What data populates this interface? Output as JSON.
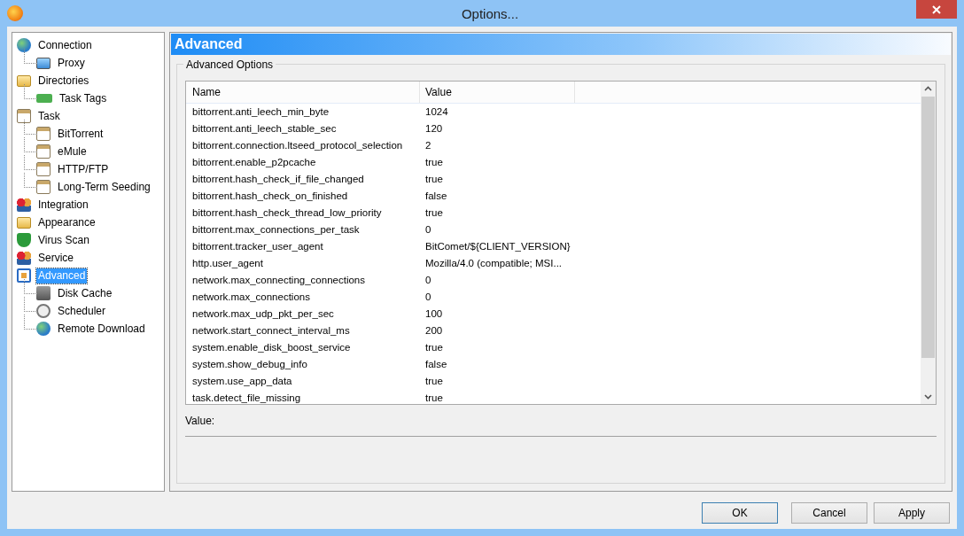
{
  "window": {
    "title": "Options..."
  },
  "sidebar": {
    "items": [
      {
        "label": "Connection",
        "selected": false,
        "children": [
          {
            "label": "Proxy",
            "selected": false
          }
        ]
      },
      {
        "label": "Directories",
        "selected": false,
        "children": [
          {
            "label": "Task Tags",
            "selected": false
          }
        ]
      },
      {
        "label": "Task",
        "selected": false,
        "children": [
          {
            "label": "BitTorrent",
            "selected": false
          },
          {
            "label": "eMule",
            "selected": false
          },
          {
            "label": "HTTP/FTP",
            "selected": false
          },
          {
            "label": "Long-Term Seeding",
            "selected": false
          }
        ]
      },
      {
        "label": "Integration",
        "selected": false
      },
      {
        "label": "Appearance",
        "selected": false
      },
      {
        "label": "Virus Scan",
        "selected": false
      },
      {
        "label": "Service",
        "selected": false
      },
      {
        "label": "Advanced",
        "selected": true,
        "children": [
          {
            "label": "Disk Cache",
            "selected": false
          },
          {
            "label": "Scheduler",
            "selected": false
          },
          {
            "label": "Remote Download",
            "selected": false
          }
        ]
      }
    ]
  },
  "page_header": "Advanced",
  "group": {
    "title": "Advanced Options",
    "table": {
      "columns": [
        "Name",
        "Value"
      ],
      "rows": [
        [
          "bittorrent.anti_leech_min_byte",
          "1024"
        ],
        [
          "bittorrent.anti_leech_stable_sec",
          "120"
        ],
        [
          "bittorrent.connection.ltseed_protocol_selection",
          "2"
        ],
        [
          "bittorrent.enable_p2pcache",
          "true"
        ],
        [
          "bittorrent.hash_check_if_file_changed",
          "true"
        ],
        [
          "bittorrent.hash_check_on_finished",
          "false"
        ],
        [
          "bittorrent.hash_check_thread_low_priority",
          "true"
        ],
        [
          "bittorrent.max_connections_per_task",
          "0"
        ],
        [
          "bittorrent.tracker_user_agent",
          "BitComet/${CLIENT_VERSION}"
        ],
        [
          "http.user_agent",
          "Mozilla/4.0 (compatible; MSI..."
        ],
        [
          "network.max_connecting_connections",
          "0"
        ],
        [
          "network.max_connections",
          "0"
        ],
        [
          "network.max_udp_pkt_per_sec",
          "100"
        ],
        [
          "network.start_connect_interval_ms",
          "200"
        ],
        [
          "system.enable_disk_boost_service",
          "true"
        ],
        [
          "system.show_debug_info",
          "false"
        ],
        [
          "system.use_app_data",
          "true"
        ],
        [
          "task.detect_file_missing",
          "true"
        ]
      ]
    },
    "value_label": "Value:"
  },
  "buttons": [
    {
      "label": "OK",
      "default": true
    },
    {
      "label": "Cancel",
      "default": false
    },
    {
      "label": "Apply",
      "default": false
    }
  ]
}
